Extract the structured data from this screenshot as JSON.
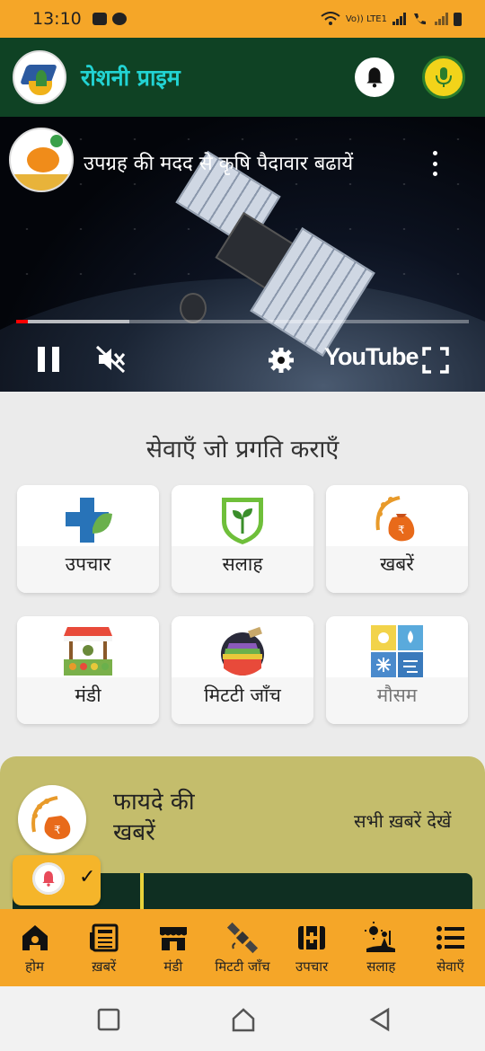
{
  "status_bar": {
    "time": "13:10",
    "network_label": "Vo)) LTE1"
  },
  "app_bar": {
    "title": "रोशनी प्राइम",
    "title_color": "#22d3d3",
    "background": "#0f4224"
  },
  "video": {
    "title": "उपग्रह की मदद से कृषि पैदावार बढायें",
    "brand": "YouTube",
    "progress_played": 0.025,
    "progress_buffered": 0.25
  },
  "services": {
    "heading": "सेवाएँ जो प्रगति कराएँ",
    "items": [
      {
        "label": "उपचार",
        "icon": "medical-cross-icon"
      },
      {
        "label": "सलाह",
        "icon": "plant-shield-icon"
      },
      {
        "label": "खबरें",
        "icon": "money-bag-wheat-icon"
      },
      {
        "label": "मंडी",
        "icon": "market-stall-icon"
      },
      {
        "label": "मिटटी जाँच",
        "icon": "satellite-field-icon"
      },
      {
        "label": "मौसम",
        "icon": "weather-icon"
      }
    ]
  },
  "news": {
    "title": "फायदे की खबरें",
    "see_all": "सभी ख़बरें देखें",
    "background": "#c4bd6c"
  },
  "bottom_nav": {
    "items": [
      {
        "label": "होम",
        "icon": "home-icon"
      },
      {
        "label": "ख़बरें",
        "icon": "newspaper-icon"
      },
      {
        "label": "मंडी",
        "icon": "shop-icon"
      },
      {
        "label": "मिटटी जाँच",
        "icon": "satellite-icon"
      },
      {
        "label": "उपचार",
        "icon": "first-aid-icon"
      },
      {
        "label": "सलाह",
        "icon": "farmer-advice-icon"
      },
      {
        "label": "सेवाएँ",
        "icon": "list-icon"
      }
    ],
    "background": "#f5a628"
  }
}
